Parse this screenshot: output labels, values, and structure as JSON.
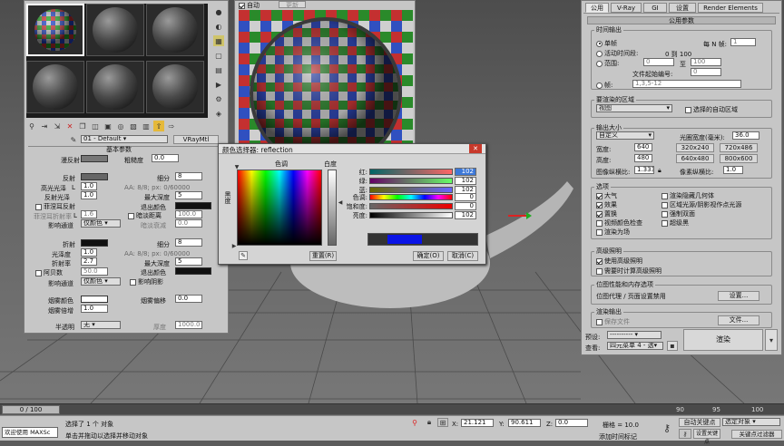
{
  "material_editor": {
    "slot_dropdown": "01 - Default",
    "material_type": "VRayMtl",
    "section_title": "基本参数",
    "rows": {
      "diffuse": "漫反射",
      "roughness_label": "粗糙度",
      "roughness_value": "0.0",
      "reflect": "反射",
      "subdivs_label": "细分",
      "subdivs_value": "8",
      "hilight_label": "高光光泽",
      "hilight_l": "L",
      "hilight_value": "1.0",
      "aa_text": "AA: 8/8; px: 0/60000",
      "refl_gloss_label": "反射光泽",
      "refl_gloss_value": "1.0",
      "max_depth_label": "最大深度",
      "max_depth_value": "5",
      "fresnel_label": "菲涅耳反射",
      "exit_color_label": "退出颜色",
      "fresnel_ior_label": "菲涅耳折射率",
      "fresnel_ior_value": "1.6",
      "dim_dist_label": "暗淡距离",
      "dim_dist_value": "100.0",
      "affect_channels_label": "影响通道",
      "affect_channels_value": "仅颜色",
      "dim_falloff_label": "暗淡衰减",
      "dim_falloff_value": "0.0",
      "refract": "折射",
      "refr_subdivs_value": "8",
      "refr_gloss_label": "光泽度",
      "refr_gloss_value": "1.0",
      "refr_aa_text": "AA: 8/8; px: 0/60000",
      "ior_label": "折射率",
      "ior_value": "2.7",
      "refr_max_depth_value": "5",
      "abbe_label": "阿贝数",
      "abbe_value": "50.0",
      "refr_exit_label": "退出颜色",
      "affect_shadows_label": "影响阴影",
      "refr_affect_value": "仅颜色",
      "fog_color_label": "烟雾颜色",
      "fog_bias_label": "烟雾偏移",
      "fog_bias_value": "0.0",
      "fog_mult_label": "烟雾倍增",
      "fog_mult_value": "1.0",
      "translucency_label": "半透明",
      "translucency_value": "无",
      "thickness_label": "厚度",
      "thickness_value": "1000.0"
    }
  },
  "render_window": {
    "auto_label": "自动",
    "top_btn": "更新"
  },
  "color_picker": {
    "title": "颜色选择器: reflection",
    "hue_label": "色调",
    "whiteness_label": "白度",
    "blackness_label": "黑度",
    "red_label": "红:",
    "red_value": "102",
    "green_label": "绿:",
    "green_value": "102",
    "blue_label": "蓝:",
    "blue_value": "102",
    "hue2_label": "色调:",
    "hue2_value": "0",
    "sat_label": "饱和度:",
    "sat_value": "0",
    "val_label": "亮度:",
    "val_value": "102",
    "reset_btn": "重置(R)",
    "ok_btn": "确定(O)",
    "cancel_btn": "取消(C)",
    "colors": {
      "blue_swatch": "#0a14e6"
    }
  },
  "render_setup": {
    "tabs": [
      "公用",
      "V-Ray",
      "GI",
      "设置",
      "Render Elements"
    ],
    "rollout_title": "公用参数",
    "time_output": {
      "title": "时间输出",
      "single": "单帧",
      "every_n_label": "每 N 帧:",
      "every_n_value": "1",
      "active_segment": "活动时间段:",
      "active_range": "0 到 100",
      "range": "范围:",
      "range_from": "0",
      "range_to_label": "至",
      "range_to": "100",
      "file_start_label": "文件起始编号:",
      "file_start_value": "0",
      "frames": "帧:",
      "frames_value": "1,3,5-12"
    },
    "area": {
      "title": "要渲染的区域",
      "view_value": "视图",
      "auto_region": "选择的自动区域"
    },
    "output_size": {
      "title": "输出大小",
      "preset": "自定义",
      "aperture_label": "光圈宽度(毫米):",
      "aperture_value": "36.0",
      "width_label": "宽度:",
      "width_value": "640",
      "height_label": "高度:",
      "height_value": "480",
      "presets": [
        "320x240",
        "720x486",
        "640x480",
        "800x600"
      ],
      "aspect_label": "图像纵横比:",
      "aspect_value": "1.333",
      "pixel_aspect_label": "像素纵横比:",
      "pixel_aspect_value": "1.0"
    },
    "options": {
      "title": "选项",
      "items_left": [
        "大气",
        "效果",
        "置换",
        "视频颜色检查",
        "渲染为场"
      ],
      "items_left_checked": [
        true,
        true,
        true,
        false,
        false
      ],
      "items_right": [
        "渲染隐藏几何体",
        "区域光源/阴影视作点光源",
        "强制双面",
        "超级黑"
      ],
      "items_right_checked": [
        false,
        false,
        false,
        false
      ]
    },
    "adv_lighting": {
      "title": "高级照明",
      "use": "使用高级照明",
      "compute": "需要时计算高级照明"
    },
    "bitmap": {
      "title": "位图性能和内存选项",
      "text": "位图代理 / 页面设置禁用",
      "btn": "设置..."
    },
    "render_output": {
      "title": "渲染输出",
      "save_file": "保存文件",
      "files_btn": "文件..."
    },
    "bottom": {
      "preset_label": "预设:",
      "preset_value": "----------",
      "view_label": "查看:",
      "view_value": "四元菜单 4 - 透",
      "render_btn": "渲染"
    }
  },
  "status_bar": {
    "frame_counter": "0 / 100",
    "welcome": "欢迎使用 MAXSc",
    "selected": "选择了 1 个 对象",
    "hint": "单击并拖动以选择并移动对象",
    "x_label": "X:",
    "x_value": "21.121",
    "y_label": "Y:",
    "y_value": "90.611",
    "z_label": "Z:",
    "z_value": "0.0",
    "grid": "栅格 = 10.0",
    "add_time_tag": "添加时间标记",
    "auto_key": "自动关键点",
    "selected_obj": "选定对象",
    "set_key": "设置关键点",
    "key_filters": "关键点过滤器"
  },
  "timeline_ticks": [
    "90",
    "95",
    "100"
  ]
}
